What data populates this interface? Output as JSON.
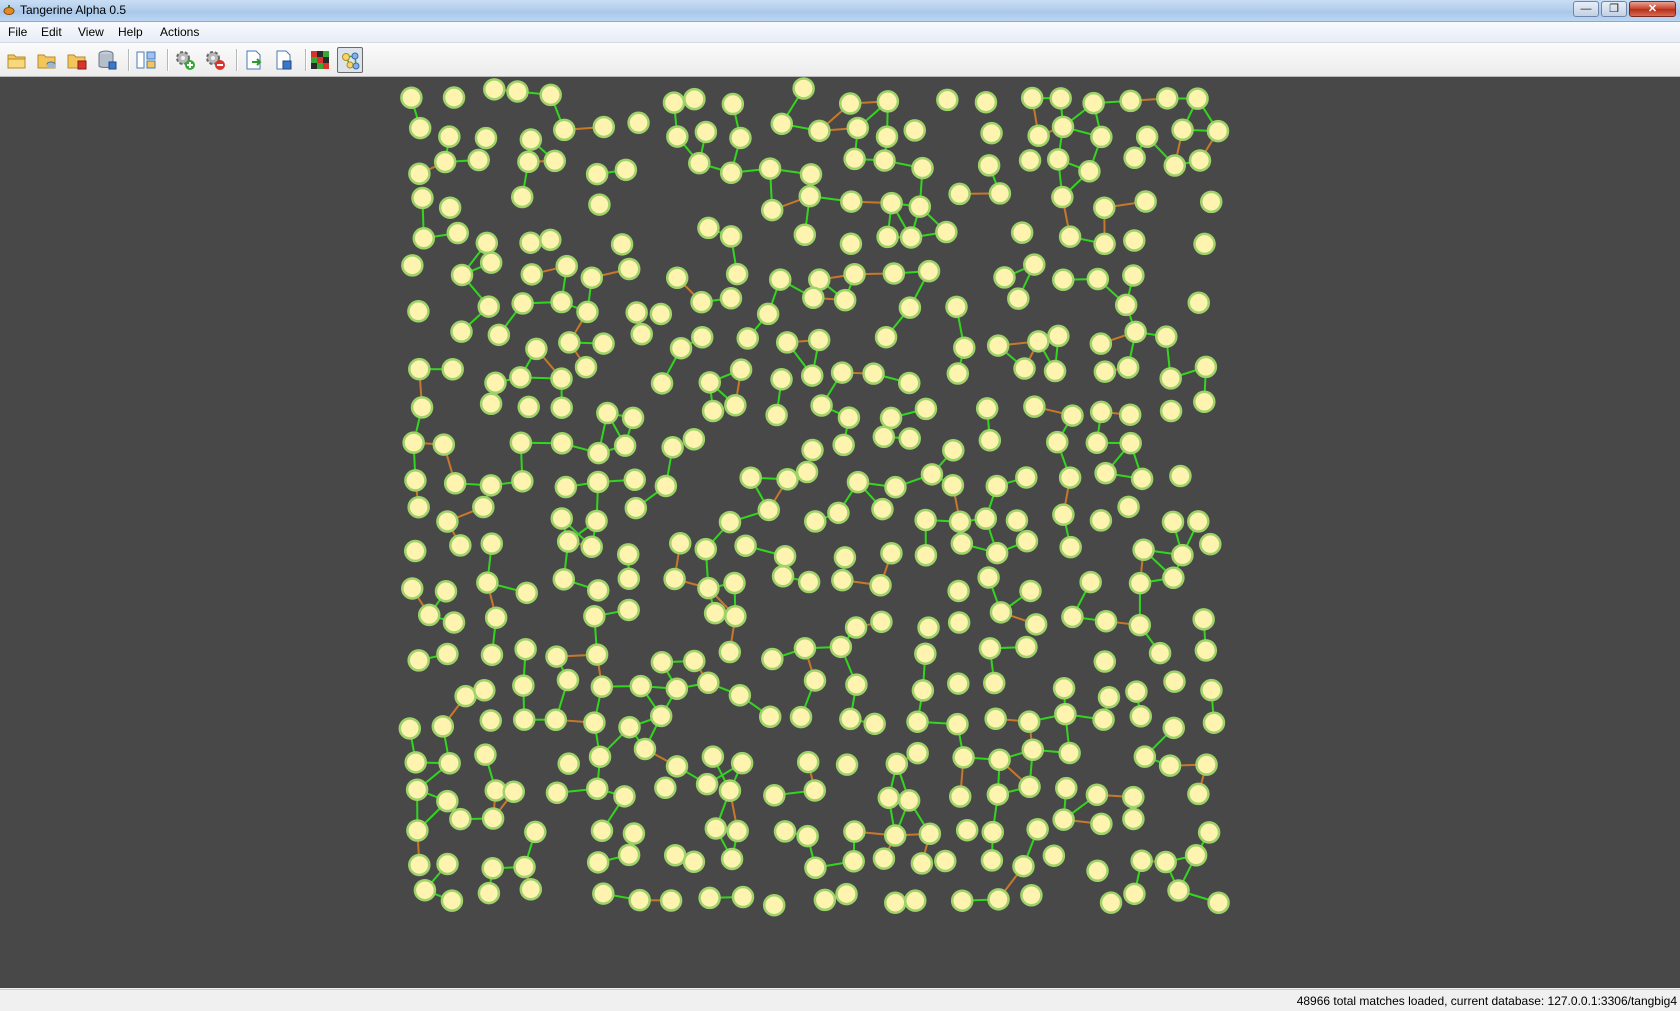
{
  "window": {
    "title": "Tangerine Alpha 0.5",
    "icon": "tangerine-app-icon",
    "controls": [
      "minimize-icon",
      "maximize-icon",
      "close-icon"
    ]
  },
  "menu": [
    "File",
    "Edit",
    "View",
    "Help",
    "Actions"
  ],
  "toolbar": {
    "buttons": [
      {
        "icon": "open-folder-icon"
      },
      {
        "icon": "open-folder-database-icon"
      },
      {
        "icon": "close-folder-icon"
      },
      {
        "icon": "save-database-icon"
      },
      {
        "icon": "layout-split-icon"
      },
      {
        "icon": "gear-add-icon"
      },
      {
        "icon": "gear-remove-icon"
      },
      {
        "icon": "export-document-icon"
      },
      {
        "icon": "save-document-icon"
      },
      {
        "icon": "color-grid-icon"
      },
      {
        "icon": "graph-view-icon",
        "active": true
      }
    ]
  },
  "graph": {
    "node_color": "#fff3b0",
    "node_border_color": "#9ed36a",
    "edge_colors": [
      "#33d61f",
      "#c8782a"
    ]
  },
  "status": {
    "text": "48966 total matches loaded, current database: 127.0.0.1:3306/tangbig4"
  }
}
